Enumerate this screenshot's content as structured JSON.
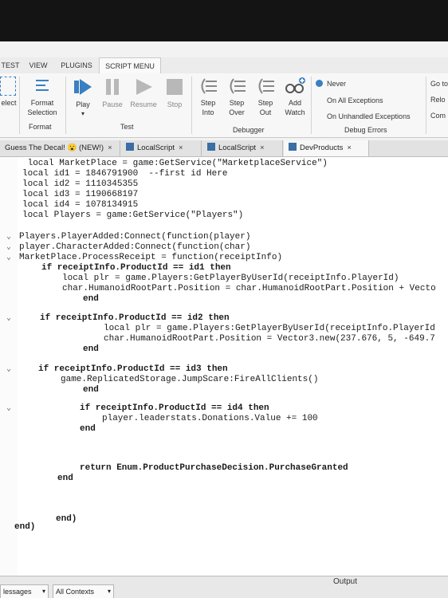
{
  "ribbon_tabs": [
    "TEST",
    "VIEW",
    "PLUGINS",
    "SCRIPT MENU"
  ],
  "ribbon": {
    "select_label": "elect",
    "format_selection": "Format Selection",
    "format_group": "Format",
    "play": "Play",
    "pause": "Pause",
    "resume": "Resume",
    "stop": "Stop",
    "test_group": "Test",
    "step_into": "Step Into",
    "step_over": "Step Over",
    "step_out": "Step Out",
    "add_watch": "Add Watch",
    "debugger_group": "Debugger",
    "never": "Never",
    "on_all_exceptions": "On All Exceptions",
    "on_unhandled_exceptions": "On Unhandled Exceptions",
    "debug_errors_group": "Debug Errors",
    "goto": "Go to",
    "reload": "Relo",
    "com": "Com"
  },
  "doc_tabs": [
    {
      "label": "Guess The Decal! 😮 (NEW!)",
      "close": "×"
    },
    {
      "label": "LocalScript",
      "close": "×"
    },
    {
      "label": "LocalScript",
      "close": "×"
    },
    {
      "label": "DevProducts",
      "close": "×"
    }
  ],
  "code": [
    "local MarketPlace = game:GetService(\"MarketplaceService\")",
    "local id1 = 1846791900  --first id Here",
    "local id2 = 1110345355",
    "local id3 = 1190668197",
    "local id4 = 1078134915",
    "local Players = game:GetService(\"Players\")",
    "Players.PlayerAdded:Connect(function(player)",
    "player.CharacterAdded:Connect(function(char)",
    "MarketPlace.ProcessReceipt = function(receiptInfo)",
    "if receiptInfo.ProductId == id1 then",
    "local plr = game.Players:GetPlayerByUserId(receiptInfo.PlayerId)",
    "char.HumanoidRootPart.Position = char.HumanoidRootPart.Position + Vecto",
    "end",
    "if receiptInfo.ProductId == id2 then",
    "local plr = game.Players:GetPlayerByUserId(receiptInfo.PlayerId",
    "char.HumanoidRootPart.Position = Vector3.new(237.676, 5, -649.7",
    "end",
    "if receiptInfo.ProductId == id3 then",
    "game.ReplicatedStorage.JumpScare:FireAllClients()",
    "end",
    "if receiptInfo.ProductId == id4 then",
    "player.leaderstats.Donations.Value += 100",
    "end",
    "return Enum.ProductPurchaseDecision.PurchaseGranted",
    "end",
    "end)",
    "end)"
  ],
  "bottom": {
    "messages": "lessages",
    "all_contexts": "All Contexts",
    "output": "Output"
  },
  "colors": {
    "keyword": "#000000",
    "property": "#3f7fb0",
    "string": "#7a4a1a",
    "play_icon": "#3a7fc1",
    "debug_icon": "#3a7fc1"
  }
}
